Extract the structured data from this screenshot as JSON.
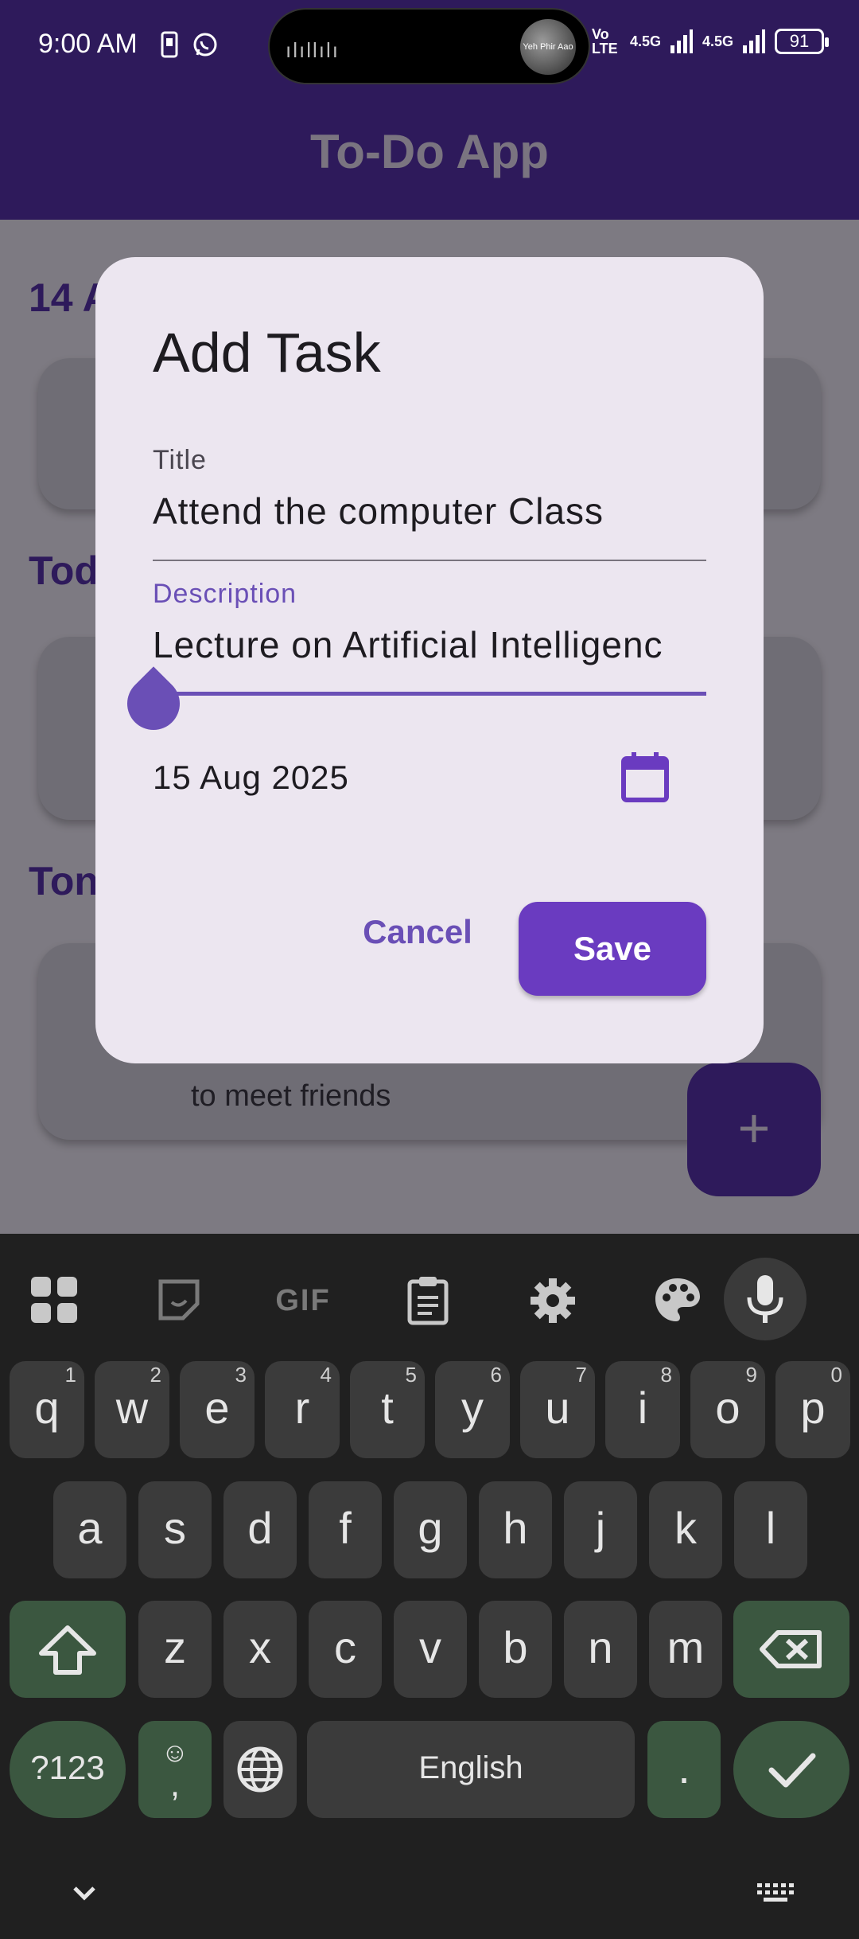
{
  "status_bar": {
    "time": "9:00 AM",
    "island_thumb_text": "Yeh Phir Aao",
    "volte": "Vo LTE",
    "net1": "4.5G",
    "net2": "4.5G",
    "battery": "91"
  },
  "app": {
    "title": "To-Do App",
    "background": {
      "section_1_partial": "14 A",
      "section_2_partial": "Tod",
      "section_3_partial": "Ton",
      "card_text": "to meet friends",
      "fab_label": "+"
    }
  },
  "dialog": {
    "title": "Add Task",
    "title_field": {
      "label": "Title",
      "value": "Attend the computer Class"
    },
    "description_field": {
      "label": "Description",
      "value": "Lecture on Artificial Intelligenc"
    },
    "date": "15 Aug 2025",
    "cancel_label": "Cancel",
    "save_label": "Save"
  },
  "keyboard": {
    "toolbar": [
      "apps-grid-icon",
      "sticker-icon",
      "gif-icon",
      "clipboard-icon",
      "gear-icon",
      "palette-icon",
      "microphone-icon"
    ],
    "gif_label": "GIF",
    "row1": [
      {
        "k": "q",
        "n": "1"
      },
      {
        "k": "w",
        "n": "2"
      },
      {
        "k": "e",
        "n": "3"
      },
      {
        "k": "r",
        "n": "4"
      },
      {
        "k": "t",
        "n": "5"
      },
      {
        "k": "y",
        "n": "6"
      },
      {
        "k": "u",
        "n": "7"
      },
      {
        "k": "i",
        "n": "8"
      },
      {
        "k": "o",
        "n": "9"
      },
      {
        "k": "p",
        "n": "0"
      }
    ],
    "row2": [
      "a",
      "s",
      "d",
      "f",
      "g",
      "h",
      "j",
      "k",
      "l"
    ],
    "row3": [
      "z",
      "x",
      "c",
      "v",
      "b",
      "n",
      "m"
    ],
    "symbols_label": "?123",
    "emoji_comma_top": "☺",
    "emoji_comma_bottom": ",",
    "space_label": "English",
    "period_label": "."
  },
  "colors": {
    "primary": "#6a3bc0",
    "app_bar": "#2e1a5b",
    "dialog_bg": "#ece6f0",
    "keyboard_bg": "#202020",
    "key_green": "#3b5740"
  }
}
